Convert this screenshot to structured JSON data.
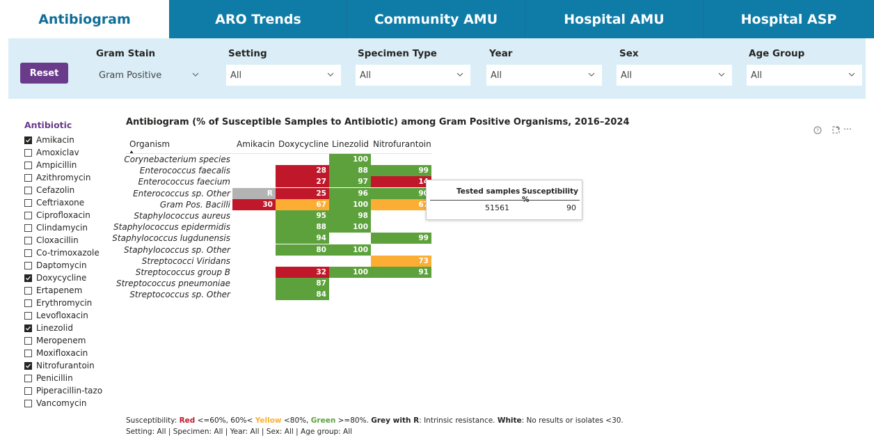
{
  "tabs": [
    {
      "label": "Antibiogram",
      "active": true
    },
    {
      "label": "ARO Trends",
      "active": false
    },
    {
      "label": "Community AMU",
      "active": false
    },
    {
      "label": "Hospital AMU",
      "active": false
    },
    {
      "label": "Hospital ASP",
      "active": false
    }
  ],
  "filters": {
    "reset_label": "Reset",
    "items": [
      {
        "label": "Gram Stain",
        "value": "Gram Positive"
      },
      {
        "label": "Setting",
        "value": "All"
      },
      {
        "label": "Specimen Type",
        "value": "All"
      },
      {
        "label": "Year",
        "value": "All"
      },
      {
        "label": "Sex",
        "value": "All"
      },
      {
        "label": "Age Group",
        "value": "All"
      }
    ]
  },
  "antibiotic_slicer": {
    "title": "Antibiotic",
    "items": [
      {
        "label": "Amikacin",
        "checked": true
      },
      {
        "label": "Amoxiclav",
        "checked": false
      },
      {
        "label": "Ampicillin",
        "checked": false
      },
      {
        "label": "Azithromycin",
        "checked": false
      },
      {
        "label": "Cefazolin",
        "checked": false
      },
      {
        "label": "Ceftriaxone",
        "checked": false
      },
      {
        "label": "Ciprofloxacin",
        "checked": false
      },
      {
        "label": "Clindamycin",
        "checked": false
      },
      {
        "label": "Cloxacillin",
        "checked": false
      },
      {
        "label": "Co-trimoxazole",
        "checked": false
      },
      {
        "label": "Daptomycin",
        "checked": false
      },
      {
        "label": "Doxycycline",
        "checked": true
      },
      {
        "label": "Ertapenem",
        "checked": false
      },
      {
        "label": "Erythromycin",
        "checked": false
      },
      {
        "label": "Levofloxacin",
        "checked": false
      },
      {
        "label": "Linezolid",
        "checked": true
      },
      {
        "label": "Meropenem",
        "checked": false
      },
      {
        "label": "Moxifloxacin",
        "checked": false
      },
      {
        "label": "Nitrofurantoin",
        "checked": true
      },
      {
        "label": "Penicillin",
        "checked": false
      },
      {
        "label": "Piperacillin-tazo",
        "checked": false
      },
      {
        "label": "Vancomycin",
        "checked": false
      }
    ]
  },
  "chart_data": {
    "type": "table",
    "title": "Antibiogram (% of Susceptible Samples to Antibiotic) among Gram Positive Organisms, 2016–2024",
    "row_header": "Organism",
    "columns": [
      "Amikacin",
      "Doxycycline",
      "Linezolid",
      "Nitrofurantoin"
    ],
    "rows": [
      {
        "organism": "Corynebacterium species",
        "values": [
          null,
          null,
          100,
          null
        ]
      },
      {
        "organism": "Enterococcus faecalis",
        "values": [
          null,
          28,
          88,
          99
        ]
      },
      {
        "organism": "Enterococcus faecium",
        "values": [
          null,
          27,
          97,
          14
        ]
      },
      {
        "organism": "Enterococcus sp. Other",
        "values": [
          "R",
          25,
          96,
          90
        ]
      },
      {
        "organism": "Gram Pos. Bacilli",
        "values": [
          30,
          67,
          100,
          67
        ]
      },
      {
        "organism": "Staphylococcus aureus",
        "values": [
          null,
          95,
          98,
          null
        ]
      },
      {
        "organism": "Staphylococcus epidermidis",
        "values": [
          null,
          88,
          100,
          null
        ]
      },
      {
        "organism": "Staphylococcus lugdunensis",
        "values": [
          null,
          94,
          null,
          99
        ]
      },
      {
        "organism": "Staphylococcus sp. Other",
        "values": [
          null,
          80,
          100,
          null
        ]
      },
      {
        "organism": "Streptococci Viridans",
        "values": [
          null,
          null,
          null,
          73
        ]
      },
      {
        "organism": "Streptococcus group B",
        "values": [
          null,
          32,
          100,
          91
        ]
      },
      {
        "organism": "Streptococcus pneumoniae",
        "values": [
          null,
          87,
          null,
          null
        ]
      },
      {
        "organism": "Streptococcus sp. Other",
        "values": [
          null,
          84,
          null,
          null
        ]
      }
    ],
    "color_rules": {
      "red": "#c0182a",
      "yellow": "#fbae33",
      "green": "#5ca13b",
      "grey": "#b3b3b3"
    }
  },
  "tooltip": {
    "col1_header": "Tested samples",
    "col2_header": "Susceptibility %",
    "col1_value": "51561",
    "col2_value": "90"
  },
  "footer": {
    "prefix": "Susceptibility: ",
    "red": "Red",
    "red_rule": " <=60%, 60%< ",
    "yellow": "Yellow",
    "yellow_rule": " <80%, ",
    "green": "Green",
    "green_rule": " >=80%. ",
    "grey": "Grey with R",
    "grey_rule": ": Intrinsic resistance. ",
    "white": "White",
    "white_rule": ": No results or isolates <30.",
    "line2": "Setting: All | Specimen: All | Year: All | Sex: All | Age group: All"
  },
  "icons": {
    "help": "help-icon",
    "focus": "focus-mode-icon",
    "more": "more-options-icon",
    "sort": "sort-ascending-icon",
    "chevron": "chevron-down-icon",
    "check": "check-icon"
  }
}
